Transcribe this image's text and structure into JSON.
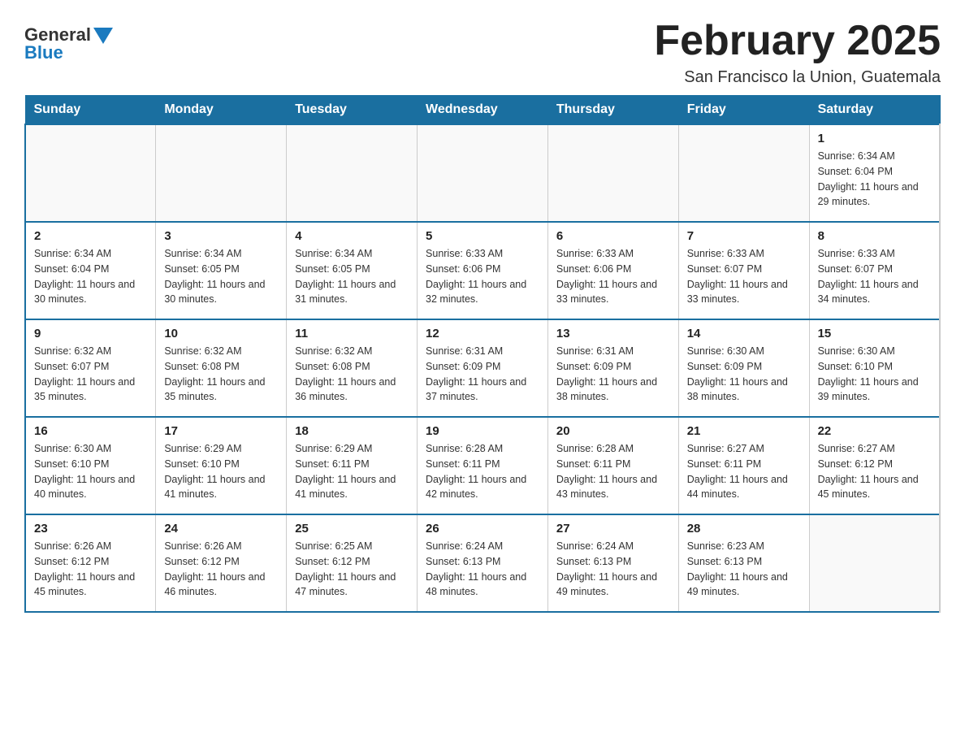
{
  "header": {
    "logo_general": "General",
    "logo_blue": "Blue",
    "month_title": "February 2025",
    "location": "San Francisco la Union, Guatemala"
  },
  "calendar": {
    "days_of_week": [
      "Sunday",
      "Monday",
      "Tuesday",
      "Wednesday",
      "Thursday",
      "Friday",
      "Saturday"
    ],
    "weeks": [
      [
        {
          "day": "",
          "info": ""
        },
        {
          "day": "",
          "info": ""
        },
        {
          "day": "",
          "info": ""
        },
        {
          "day": "",
          "info": ""
        },
        {
          "day": "",
          "info": ""
        },
        {
          "day": "",
          "info": ""
        },
        {
          "day": "1",
          "info": "Sunrise: 6:34 AM\nSunset: 6:04 PM\nDaylight: 11 hours and 29 minutes."
        }
      ],
      [
        {
          "day": "2",
          "info": "Sunrise: 6:34 AM\nSunset: 6:04 PM\nDaylight: 11 hours and 30 minutes."
        },
        {
          "day": "3",
          "info": "Sunrise: 6:34 AM\nSunset: 6:05 PM\nDaylight: 11 hours and 30 minutes."
        },
        {
          "day": "4",
          "info": "Sunrise: 6:34 AM\nSunset: 6:05 PM\nDaylight: 11 hours and 31 minutes."
        },
        {
          "day": "5",
          "info": "Sunrise: 6:33 AM\nSunset: 6:06 PM\nDaylight: 11 hours and 32 minutes."
        },
        {
          "day": "6",
          "info": "Sunrise: 6:33 AM\nSunset: 6:06 PM\nDaylight: 11 hours and 33 minutes."
        },
        {
          "day": "7",
          "info": "Sunrise: 6:33 AM\nSunset: 6:07 PM\nDaylight: 11 hours and 33 minutes."
        },
        {
          "day": "8",
          "info": "Sunrise: 6:33 AM\nSunset: 6:07 PM\nDaylight: 11 hours and 34 minutes."
        }
      ],
      [
        {
          "day": "9",
          "info": "Sunrise: 6:32 AM\nSunset: 6:07 PM\nDaylight: 11 hours and 35 minutes."
        },
        {
          "day": "10",
          "info": "Sunrise: 6:32 AM\nSunset: 6:08 PM\nDaylight: 11 hours and 35 minutes."
        },
        {
          "day": "11",
          "info": "Sunrise: 6:32 AM\nSunset: 6:08 PM\nDaylight: 11 hours and 36 minutes."
        },
        {
          "day": "12",
          "info": "Sunrise: 6:31 AM\nSunset: 6:09 PM\nDaylight: 11 hours and 37 minutes."
        },
        {
          "day": "13",
          "info": "Sunrise: 6:31 AM\nSunset: 6:09 PM\nDaylight: 11 hours and 38 minutes."
        },
        {
          "day": "14",
          "info": "Sunrise: 6:30 AM\nSunset: 6:09 PM\nDaylight: 11 hours and 38 minutes."
        },
        {
          "day": "15",
          "info": "Sunrise: 6:30 AM\nSunset: 6:10 PM\nDaylight: 11 hours and 39 minutes."
        }
      ],
      [
        {
          "day": "16",
          "info": "Sunrise: 6:30 AM\nSunset: 6:10 PM\nDaylight: 11 hours and 40 minutes."
        },
        {
          "day": "17",
          "info": "Sunrise: 6:29 AM\nSunset: 6:10 PM\nDaylight: 11 hours and 41 minutes."
        },
        {
          "day": "18",
          "info": "Sunrise: 6:29 AM\nSunset: 6:11 PM\nDaylight: 11 hours and 41 minutes."
        },
        {
          "day": "19",
          "info": "Sunrise: 6:28 AM\nSunset: 6:11 PM\nDaylight: 11 hours and 42 minutes."
        },
        {
          "day": "20",
          "info": "Sunrise: 6:28 AM\nSunset: 6:11 PM\nDaylight: 11 hours and 43 minutes."
        },
        {
          "day": "21",
          "info": "Sunrise: 6:27 AM\nSunset: 6:11 PM\nDaylight: 11 hours and 44 minutes."
        },
        {
          "day": "22",
          "info": "Sunrise: 6:27 AM\nSunset: 6:12 PM\nDaylight: 11 hours and 45 minutes."
        }
      ],
      [
        {
          "day": "23",
          "info": "Sunrise: 6:26 AM\nSunset: 6:12 PM\nDaylight: 11 hours and 45 minutes."
        },
        {
          "day": "24",
          "info": "Sunrise: 6:26 AM\nSunset: 6:12 PM\nDaylight: 11 hours and 46 minutes."
        },
        {
          "day": "25",
          "info": "Sunrise: 6:25 AM\nSunset: 6:12 PM\nDaylight: 11 hours and 47 minutes."
        },
        {
          "day": "26",
          "info": "Sunrise: 6:24 AM\nSunset: 6:13 PM\nDaylight: 11 hours and 48 minutes."
        },
        {
          "day": "27",
          "info": "Sunrise: 6:24 AM\nSunset: 6:13 PM\nDaylight: 11 hours and 49 minutes."
        },
        {
          "day": "28",
          "info": "Sunrise: 6:23 AM\nSunset: 6:13 PM\nDaylight: 11 hours and 49 minutes."
        },
        {
          "day": "",
          "info": ""
        }
      ]
    ]
  }
}
